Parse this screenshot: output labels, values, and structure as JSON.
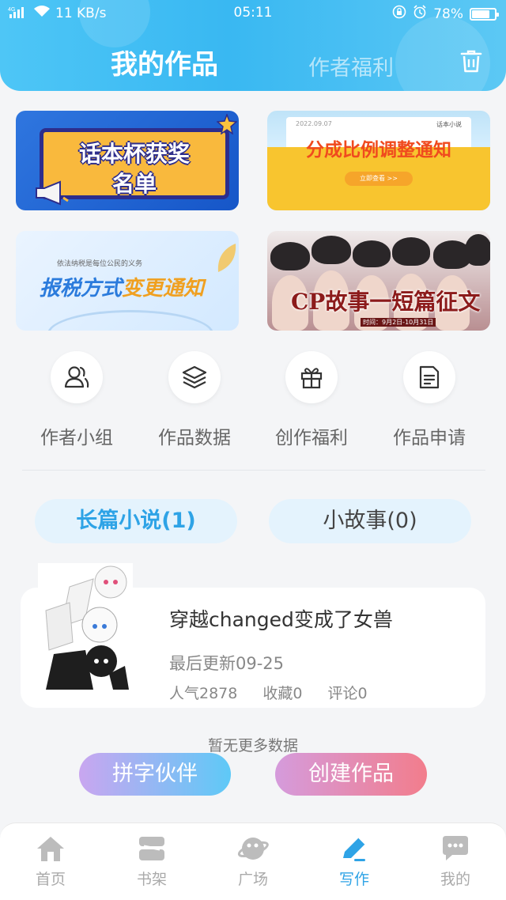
{
  "status_bar": {
    "network": "4G",
    "speed": "11 KB/s",
    "time": "05:11",
    "battery": "78%",
    "battery_level": 0.78
  },
  "header": {
    "tab_active": "我的作品",
    "tab_other": "作者福利"
  },
  "banners": {
    "b1": {
      "line1": "话本杯获奖",
      "line2": "名单"
    },
    "b2": {
      "date": "2022.09.07",
      "source": "话本小说",
      "title": "分成比例调整通知",
      "button": "立即查看 >>"
    },
    "b3": {
      "subtitle": "依法纳税是每位公民的义务",
      "title_a": "报税方式",
      "title_b": "变更通知"
    },
    "b4": {
      "title": "CP故事一短篇征文",
      "small": "时间：9月2日-10月31日"
    }
  },
  "quick_actions": [
    {
      "label": "作者小组",
      "icon": "group-icon"
    },
    {
      "label": "作品数据",
      "icon": "layers-icon"
    },
    {
      "label": "创作福利",
      "icon": "gift-icon"
    },
    {
      "label": "作品申请",
      "icon": "document-icon"
    }
  ],
  "tabs": {
    "long": "长篇小说(1)",
    "short": "小故事(0)"
  },
  "work": {
    "title": "穿越changed变成了女兽",
    "updated": "最后更新09-25",
    "popularity": "人气2878",
    "favorites": "收藏0",
    "comments": "评论0"
  },
  "no_more": "暂无更多数据",
  "buttons": {
    "partner": "拼字伙伴",
    "create": "创建作品"
  },
  "bottom_nav": [
    {
      "label": "首页",
      "icon": "home-icon"
    },
    {
      "label": "书架",
      "icon": "bookshelf-icon"
    },
    {
      "label": "广场",
      "icon": "planet-icon"
    },
    {
      "label": "写作",
      "icon": "pen-icon",
      "active": true
    },
    {
      "label": "我的",
      "icon": "chat-bubble-icon"
    }
  ],
  "colors": {
    "accent": "#2ea3e6",
    "header": "#39b8f2"
  }
}
